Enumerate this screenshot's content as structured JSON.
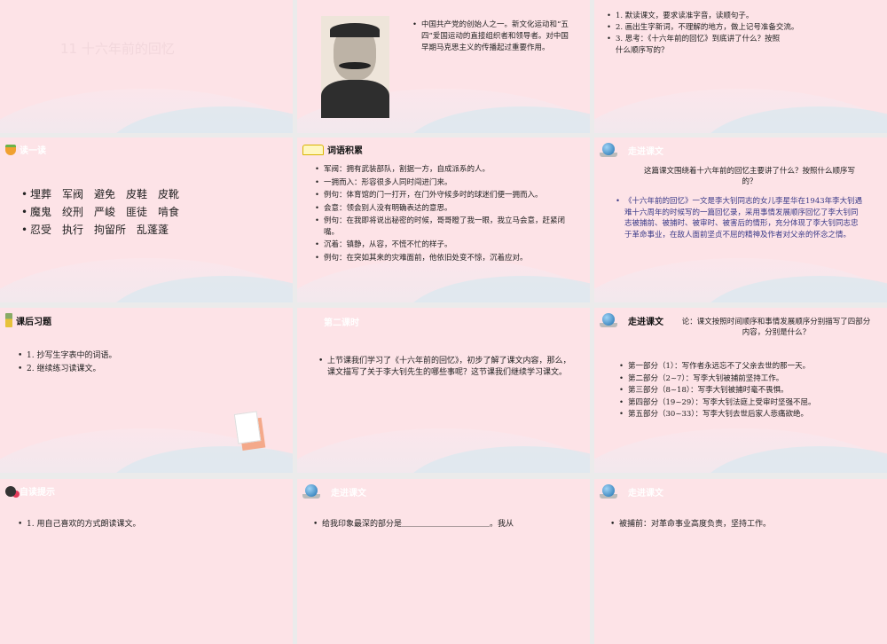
{
  "slides": [
    {
      "title": "11  十六年前的回忆"
    },
    {
      "bullets": [
        "中国共产党的创始人之一。新文化运动和“五四”爱国运动的直接组织者和领导者。对中国早期马克思主义的传播起过重要作用。"
      ],
      "image": "portrait of Li Dazhao"
    },
    {
      "bullets": [
        "1. 默读课文，要求读准字音，读顺句子。",
        "2. 画出生字新词，不理解的地方，做上记号准备交流。",
        "3. 思考：《十六年前的回忆》到底讲了什么？按照什么顺序写的？"
      ]
    },
    {
      "heading": "读一读",
      "bullets": [
        "埋葬　军阀　避免　皮鞋　皮靴",
        "魔鬼　绞刑　严峻　匪徒　啃食",
        "忍受　执行　拘留所　乱蓬蓬"
      ]
    },
    {
      "heading": "词语积累",
      "bullets": [
        "军阀：拥有武装部队，割据一方，自成派系的人。",
        "一拥而入：形容很多人同时闯进门来。",
        "例句：体育馆的门一打开，在门外守候多时的球迷们便一拥而入。",
        "会意：领会别人没有明确表达的意思。",
        "例句：在我即将说出秘密的时候，哥哥瞪了我一眼，我立马会意，赶紧闭嘴。",
        "沉着：镇静，从容，不慌不忙的样子。",
        "例句：在突如其来的灾难面前，他依旧处变不惊，沉着应对。"
      ]
    },
    {
      "heading": "走进课文",
      "question": "这篇课文围绕着十六年前的回忆主要讲了什么？按照什么顺序写的？",
      "bullets": [
        "《十六年前的回忆》一文是李大钊同志的女儿李星华在1943年李大钊遇难十六周年的时候写的一篇回忆录，采用事情发展顺序回忆了李大钊同志被捕前、被捕时、被审时、被害后的情形，充分体现了李大钊同志忠于革命事业，在敌人面前坚贞不屈的精神及作者对父亲的怀念之情。"
      ]
    },
    {
      "heading": "课后习题",
      "bullets": [
        "1. 抄写生字表中的词语。",
        "2. 继续练习读课文。"
      ]
    },
    {
      "heading": "第二课时",
      "bullets": [
        "上节课我们学习了《十六年前的回忆》，初步了解了课文内容，那么，课文描写了关于李大钊先生的哪些事呢？这节课我们继续学习课文。"
      ]
    },
    {
      "heading": "走进课文",
      "question": "论：课文按照时间顺序和事情发展顺序分别描写了四部分内容，分别是什么？",
      "bullets": [
        "第一部分（1）：写作者永远忘不了父亲去世的那一天。",
        "第二部分（2~7）：写李大钊被捕前坚持工作。",
        "第三部分（8~18）：写李大钊被捕时毫不畏惧。",
        "第四部分（19~29）：写李大钊法庭上受审时坚强不屈。",
        "第五部分（30~33）：写李大钊去世后家人悲痛欲绝。"
      ]
    },
    {
      "heading": "自读提示",
      "bullets": [
        "1. 用自己喜欢的方式朗读课文。"
      ]
    },
    {
      "heading": "走进课文",
      "bullets": [
        "给我印象最深的部分是＿＿＿＿＿＿＿＿＿＿＿。我从"
      ]
    },
    {
      "heading": "走进课文",
      "bullets": [
        "被捕前：对革命事业高度负责，坚持工作。"
      ]
    }
  ]
}
